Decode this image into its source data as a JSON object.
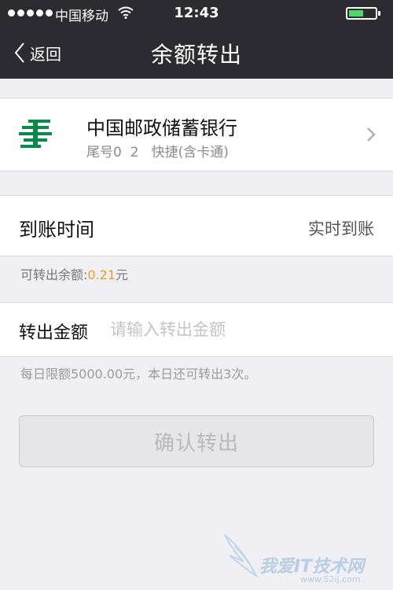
{
  "status_bar": {
    "carrier": "中国移动",
    "time": "12:43",
    "battery_level": 0.55,
    "colors": {
      "battery": "#4cd964"
    }
  },
  "nav": {
    "back_label": "返回",
    "title": "余额转出"
  },
  "bank": {
    "icon": "china-post-bank-logo",
    "name": "中国邮政储蓄银行",
    "card_info": "尾号0  2   快捷(含卡通)"
  },
  "arrival": {
    "label": "到账时间",
    "value": "实时到账"
  },
  "balance": {
    "prefix": "可转出余额:",
    "amount": "0.21",
    "unit": "元"
  },
  "transfer": {
    "label": "转出金额",
    "placeholder": "请输入转出金额",
    "value": ""
  },
  "limit_note": "每日限额5000.00元，本日还可转出3次。",
  "confirm_label": "确认转出",
  "watermark": {
    "text": "我爱IT技术网",
    "sub": "www.52ij.com"
  },
  "colors": {
    "nav_bg": "#2b2b31",
    "page_bg": "#efeff4",
    "accent_orange": "#f79a1e",
    "bank_green": "#0a8a4a"
  }
}
